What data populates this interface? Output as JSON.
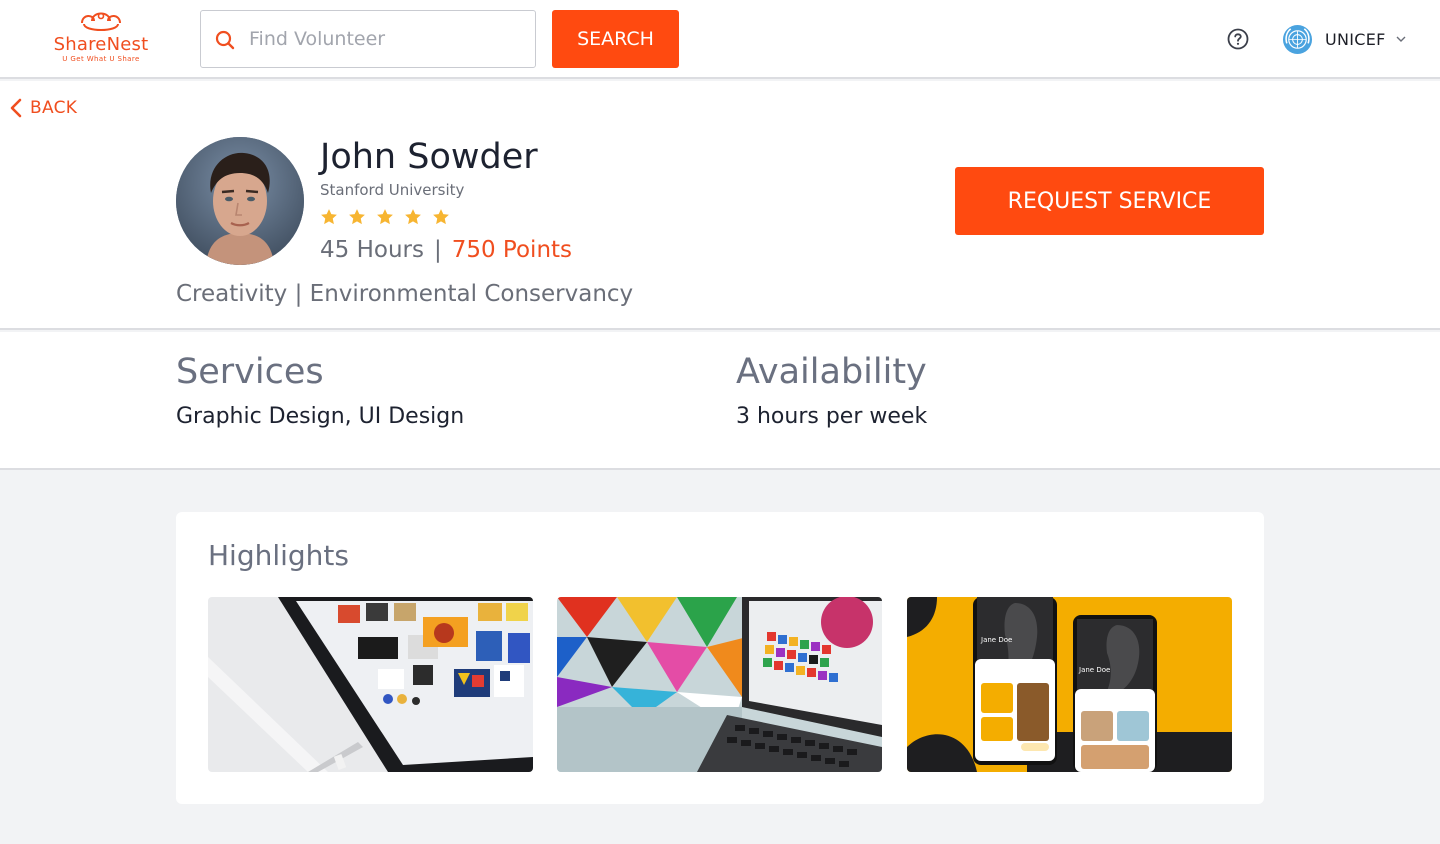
{
  "brand": {
    "name": "ShareNest",
    "tagline": "U Get What U Share",
    "logo_icon": "nest-logo-icon",
    "accent_color": "#ff4a10"
  },
  "search": {
    "placeholder": "Find Volunteer",
    "value": "",
    "button_label": "SEARCH",
    "icon": "search-icon"
  },
  "header": {
    "help_icon": "question-circle-icon",
    "org_name": "UNICEF",
    "org_logo": "un-emblem-icon",
    "org_dropdown_icon": "chevron-down-icon"
  },
  "nav": {
    "back_label": "BACK",
    "back_icon": "chevron-left-icon"
  },
  "profile": {
    "name": "John Sowder",
    "school": "Stanford University",
    "rating": 5,
    "rating_max": 5,
    "hours": "45 Hours",
    "separator": "|",
    "points": "750 Points",
    "interests": "Creativity | Environmental Conservancy",
    "request_label": "REQUEST SERVICE",
    "star_color": "#f7b531"
  },
  "details": {
    "services_title": "Services",
    "services_value": "Graphic Design, UI Design",
    "availability_title": "Availability",
    "availability_value": "3 hours per week"
  },
  "highlights": {
    "title": "Highlights",
    "phone_name_1": "Jane Doe",
    "phone_name_2": "Jane Doe"
  }
}
